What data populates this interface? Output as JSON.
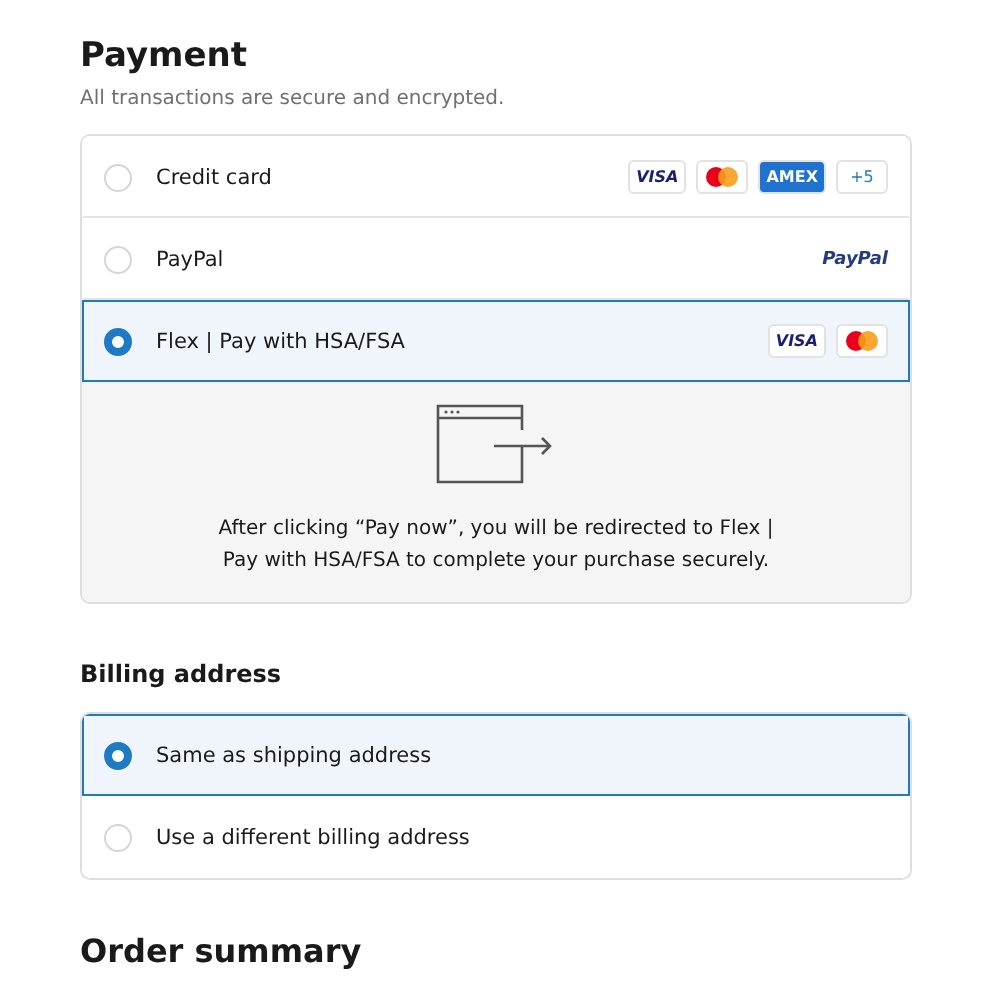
{
  "payment": {
    "title": "Payment",
    "subtitle": "All transactions are secure and encrypted.",
    "methods": [
      {
        "label": "Credit card",
        "selected": false,
        "badges": [
          {
            "kind": "visa",
            "label": "VISA"
          },
          {
            "kind": "mastercard"
          },
          {
            "kind": "amex",
            "label": "AMEX"
          },
          {
            "kind": "more",
            "label": "+5"
          }
        ]
      },
      {
        "label": "PayPal",
        "selected": false,
        "badges": [
          {
            "kind": "paypal",
            "label": "PayPal"
          }
        ]
      },
      {
        "label": "Flex | Pay with HSA/FSA",
        "selected": true,
        "badges": [
          {
            "kind": "visa",
            "label": "VISA"
          },
          {
            "kind": "mastercard"
          }
        ],
        "note": "After clicking “Pay now”, you will be redirected to Flex | Pay with HSA/FSA to complete your purchase securely."
      }
    ]
  },
  "billing": {
    "title": "Billing address",
    "options": [
      {
        "label": "Same as shipping address",
        "selected": true
      },
      {
        "label": "Use a different billing address",
        "selected": false
      }
    ]
  },
  "order_summary": {
    "title": "Order summary"
  }
}
